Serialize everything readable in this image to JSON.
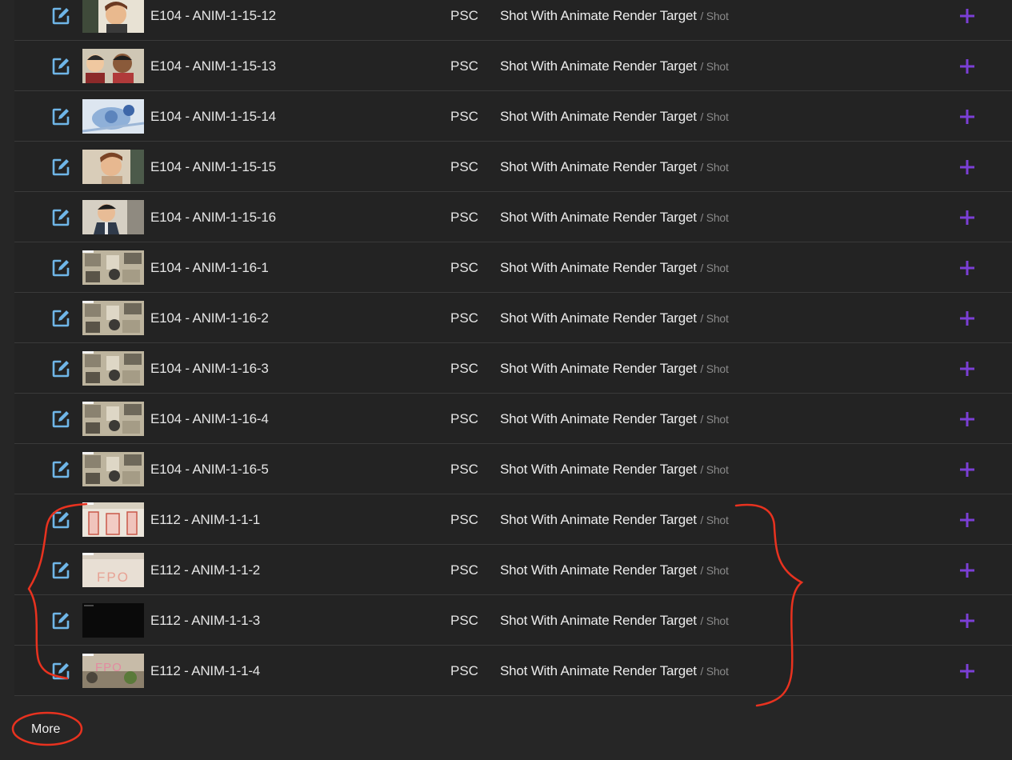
{
  "rows": [
    {
      "name": "E104 - ANIM-1-15-12",
      "code": "PSC",
      "target": "Shot With Animate Render Target",
      "type": "/ Shot",
      "thumb": "character-face-1"
    },
    {
      "name": "E104 - ANIM-1-15-13",
      "code": "PSC",
      "target": "Shot With Animate Render Target",
      "type": "/ Shot",
      "thumb": "two-characters"
    },
    {
      "name": "E104 - ANIM-1-15-14",
      "code": "PSC",
      "target": "Shot With Animate Render Target",
      "type": "/ Shot",
      "thumb": "blue-sketch"
    },
    {
      "name": "E104 - ANIM-1-15-15",
      "code": "PSC",
      "target": "Shot With Animate Render Target",
      "type": "/ Shot",
      "thumb": "character-face-2"
    },
    {
      "name": "E104 - ANIM-1-15-16",
      "code": "PSC",
      "target": "Shot With Animate Render Target",
      "type": "/ Shot",
      "thumb": "character-suit"
    },
    {
      "name": "E104 - ANIM-1-16-1",
      "code": "PSC",
      "target": "Shot With Animate Render Target",
      "type": "/ Shot",
      "thumb": "room-scene"
    },
    {
      "name": "E104 - ANIM-1-16-2",
      "code": "PSC",
      "target": "Shot With Animate Render Target",
      "type": "/ Shot",
      "thumb": "room-scene"
    },
    {
      "name": "E104 - ANIM-1-16-3",
      "code": "PSC",
      "target": "Shot With Animate Render Target",
      "type": "/ Shot",
      "thumb": "room-scene"
    },
    {
      "name": "E104 - ANIM-1-16-4",
      "code": "PSC",
      "target": "Shot With Animate Render Target",
      "type": "/ Shot",
      "thumb": "room-scene"
    },
    {
      "name": "E104 - ANIM-1-16-5",
      "code": "PSC",
      "target": "Shot With Animate Render Target",
      "type": "/ Shot",
      "thumb": "room-scene"
    },
    {
      "name": "E112 - ANIM-1-1-1",
      "code": "PSC",
      "target": "Shot With Animate Render Target",
      "type": "/ Shot",
      "thumb": "fpo-red"
    },
    {
      "name": "E112 - ANIM-1-1-2",
      "code": "PSC",
      "target": "Shot With Animate Render Target",
      "type": "/ Shot",
      "thumb": "fpo-text"
    },
    {
      "name": "E112 - ANIM-1-1-3",
      "code": "PSC",
      "target": "Shot With Animate Render Target",
      "type": "/ Shot",
      "thumb": "black-frame"
    },
    {
      "name": "E112 - ANIM-1-1-4",
      "code": "PSC",
      "target": "Shot With Animate Render Target",
      "type": "/ Shot",
      "thumb": "fpo-scene"
    }
  ],
  "more_label": "More",
  "colors": {
    "background": "#262626",
    "row": "#232323",
    "divider": "#3a3a3a",
    "plus": "#7b3fd6",
    "edit_icon": "#6fb6e8",
    "annotation": "#e8321f"
  },
  "icons": {
    "edit": "external-edit-icon",
    "add": "plus-icon"
  }
}
